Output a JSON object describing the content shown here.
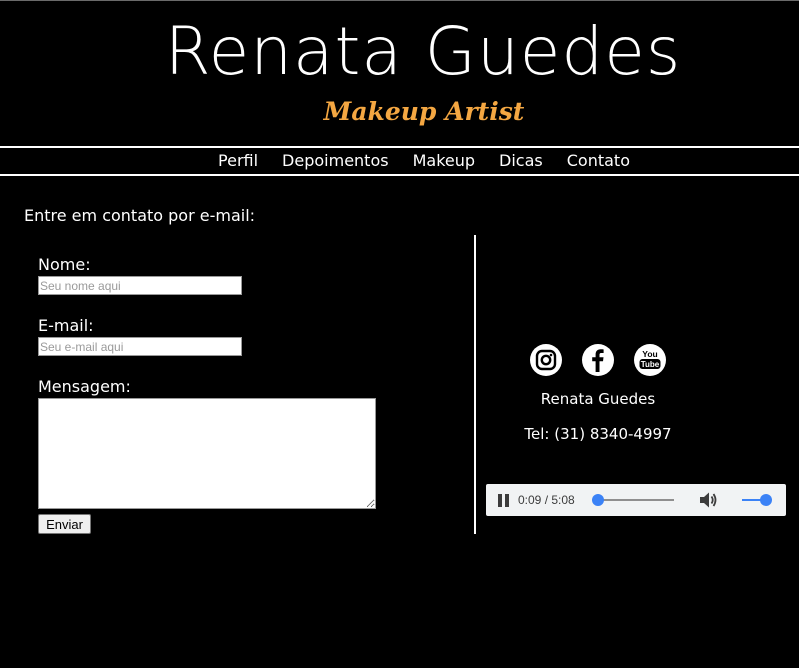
{
  "brand": {
    "title": "Renata Guedes",
    "subtitle": "Makeup Artist",
    "subtitle_color": "#f4a742"
  },
  "nav": {
    "items": [
      {
        "label": "Perfil"
      },
      {
        "label": "Depoimentos"
      },
      {
        "label": "Makeup"
      },
      {
        "label": "Dicas"
      },
      {
        "label": "Contato"
      }
    ]
  },
  "contact": {
    "heading": "Entre em contato por e-mail:",
    "name_label": "Nome:",
    "name_placeholder": "Seu nome aqui",
    "email_label": "E-mail:",
    "email_placeholder": "Seu e-mail aqui",
    "message_label": "Mensagem:",
    "message_value": "",
    "submit_label": "Enviar"
  },
  "sidebar": {
    "social": [
      {
        "icon": "instagram-icon"
      },
      {
        "icon": "facebook-icon"
      },
      {
        "icon": "youtube-icon"
      }
    ],
    "name": "Renata Guedes",
    "phone": "Tel: (31) 8340-4997"
  },
  "audio": {
    "time_label": "0:09 / 5:08",
    "progress": 0.03,
    "volume": 0.85,
    "accent": "#3b82f6"
  }
}
